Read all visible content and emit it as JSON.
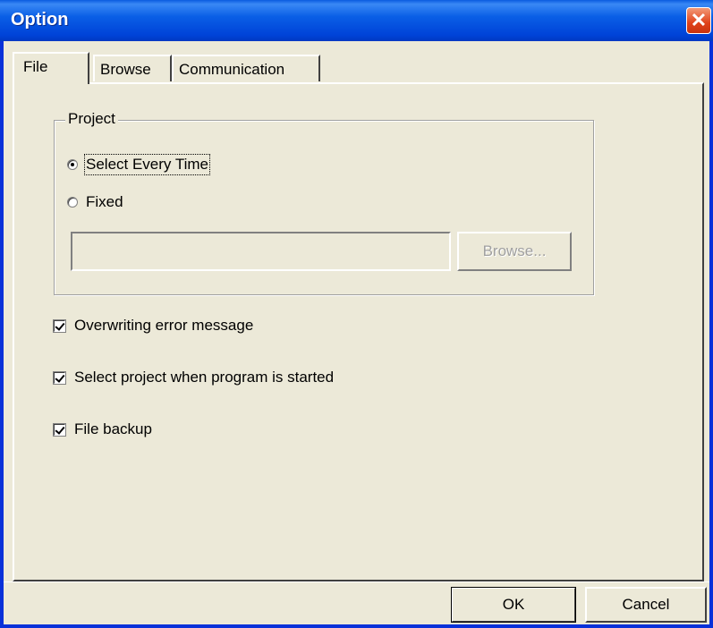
{
  "window": {
    "title": "Option",
    "close_glyph": "✕"
  },
  "tabs": [
    {
      "label": "File",
      "active": true
    },
    {
      "label": "Browse",
      "active": false
    },
    {
      "label": "Communication",
      "active": false
    }
  ],
  "project_group": {
    "legend": "Project",
    "options": [
      {
        "label": "Select Every Time",
        "checked": true
      },
      {
        "label": "Fixed",
        "checked": false
      }
    ],
    "path_value": "",
    "browse_label": "Browse..."
  },
  "checkboxes": [
    {
      "label": "Overwriting error message",
      "checked": true
    },
    {
      "label": "Select project when program is started",
      "checked": true
    },
    {
      "label": "File backup",
      "checked": true
    }
  ],
  "buttons": {
    "ok": "OK",
    "cancel": "Cancel"
  }
}
